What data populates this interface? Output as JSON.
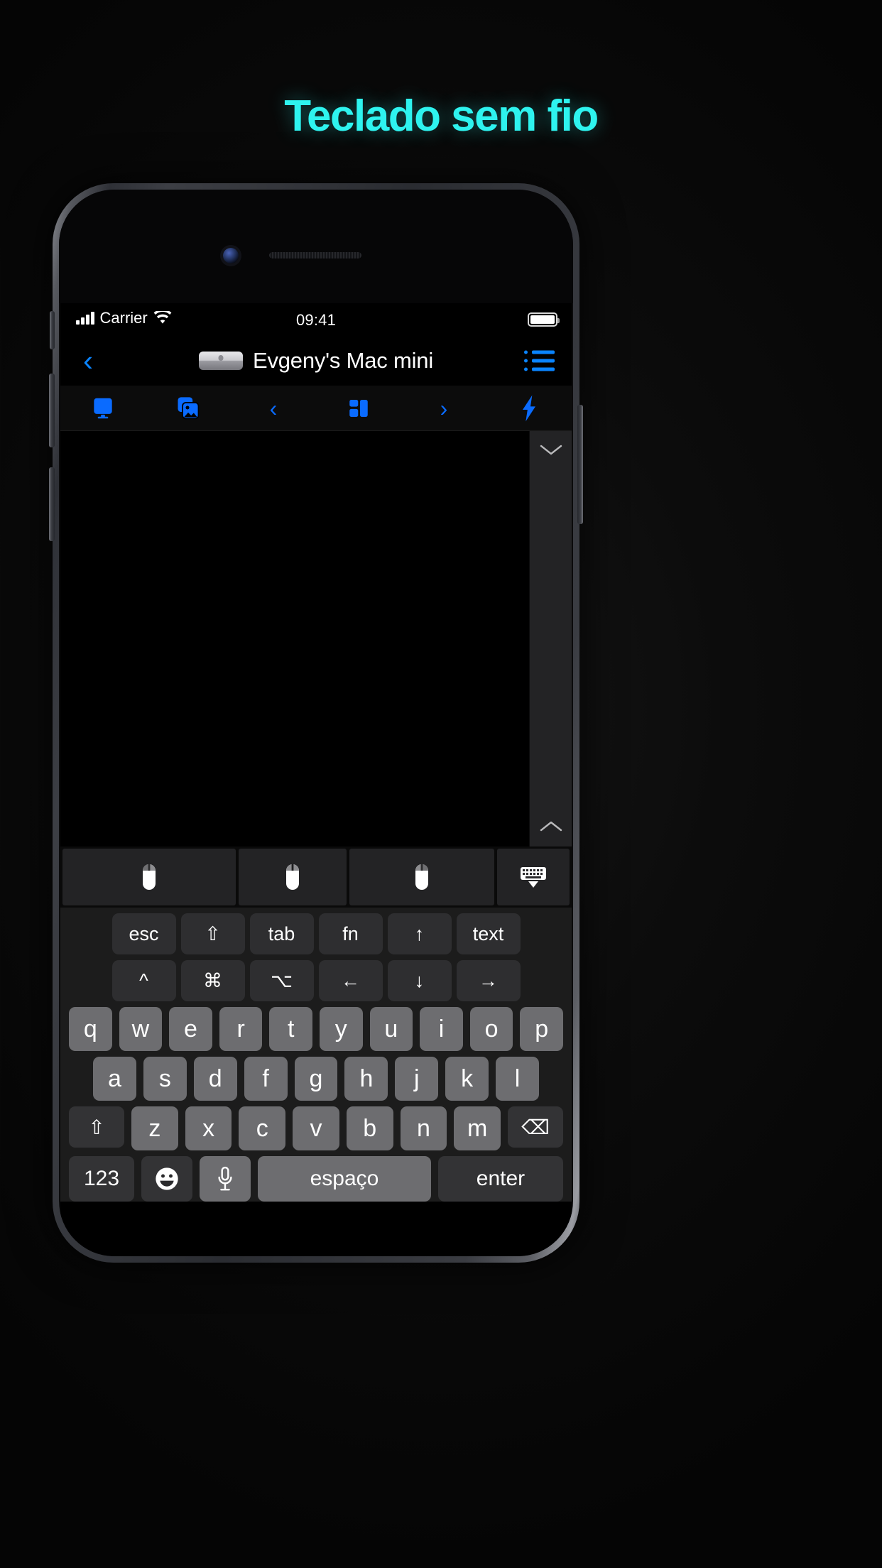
{
  "headline": "Teclado sem fio",
  "status_bar": {
    "carrier": "Carrier",
    "time": "09:41",
    "signal_icon": "cellular-bars-icon",
    "wifi_icon": "wifi-icon",
    "battery_icon": "battery-full-icon"
  },
  "nav_bar": {
    "back_glyph": "‹",
    "back_label": "back-button",
    "device_icon": "mac-mini-icon",
    "title": "Evgeny's Mac mini",
    "list_icon": "list-bullet-icon"
  },
  "toolbar": {
    "items": [
      {
        "name": "display-icon",
        "label": "Display"
      },
      {
        "name": "screens-photos-icon",
        "label": "Screens"
      },
      {
        "name": "chevron-left-icon",
        "glyph": "‹",
        "label": "Previous"
      },
      {
        "name": "layout-grid-icon",
        "label": "Layout"
      },
      {
        "name": "chevron-right-icon",
        "glyph": "›",
        "label": "Next"
      },
      {
        "name": "lightning-bolt-icon",
        "label": "Power"
      }
    ]
  },
  "remote_screen": {
    "scrollbar": {
      "down_glyph": "⌄",
      "up_glyph": "⌃"
    }
  },
  "mouse_bar": {
    "buttons": [
      {
        "name": "mouse-left-button",
        "label": "Left click"
      },
      {
        "name": "mouse-middle-button",
        "label": "Middle click"
      },
      {
        "name": "mouse-right-button",
        "label": "Right click"
      },
      {
        "name": "hide-keyboard-button",
        "label": "Hide keyboard"
      }
    ]
  },
  "keyboard": {
    "fn_row_1": [
      {
        "key": "esc",
        "label": "esc"
      },
      {
        "key": "shift",
        "label": "⇧"
      },
      {
        "key": "tab",
        "label": "tab"
      },
      {
        "key": "fn",
        "label": "fn"
      },
      {
        "key": "up",
        "label": "↑"
      },
      {
        "key": "text",
        "label": "text"
      }
    ],
    "fn_row_2": [
      {
        "key": "control",
        "label": "^"
      },
      {
        "key": "command",
        "label": "⌘"
      },
      {
        "key": "option",
        "label": "⌥"
      },
      {
        "key": "left",
        "label": "←"
      },
      {
        "key": "down",
        "label": "↓"
      },
      {
        "key": "right",
        "label": "→"
      }
    ],
    "row_q": [
      "q",
      "w",
      "e",
      "r",
      "t",
      "y",
      "u",
      "i",
      "o",
      "p"
    ],
    "row_a": [
      "a",
      "s",
      "d",
      "f",
      "g",
      "h",
      "j",
      "k",
      "l"
    ],
    "row_z": {
      "shift_label": "⇧",
      "letters": [
        "z",
        "x",
        "c",
        "v",
        "b",
        "n",
        "m"
      ],
      "backspace_label": "⌫"
    },
    "bottom_row": {
      "numbers_label": "123",
      "emoji_label": "emoji-smiley-icon",
      "mic_label": "microphone-icon",
      "space_label": "espaço",
      "enter_label": "enter"
    }
  },
  "colors": {
    "headline": "#2ef3ef",
    "accent_blue": "#0a84ff",
    "toolbar_blue": "#0a6bff",
    "key_letter_bg": "#6d6d70",
    "key_fn_bg": "#333335"
  }
}
